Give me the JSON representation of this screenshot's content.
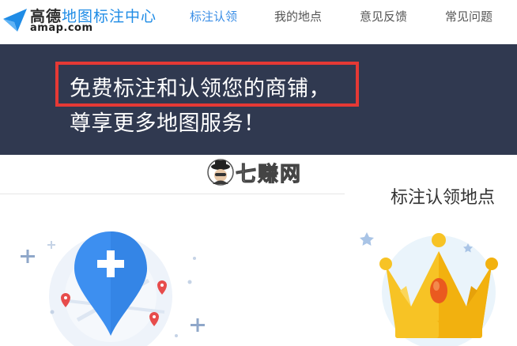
{
  "header": {
    "brand_main": "高德",
    "brand_sub": "地图标注中心",
    "domain": "amap.com",
    "nav": [
      {
        "label": "标注认领",
        "active": true
      },
      {
        "label": "我的地点",
        "active": false
      },
      {
        "label": "意见反馈",
        "active": false
      },
      {
        "label": "常见问题",
        "active": false
      }
    ]
  },
  "banner": {
    "line1": "免费标注和认领您的商铺，",
    "line2": "尊享更多地图服务！",
    "highlight_color": "#e53935",
    "background": "#303950"
  },
  "watermark": {
    "text": "七赚网"
  },
  "card": {
    "title": "标注认领地点"
  },
  "colors": {
    "accent": "#3a8ee6",
    "pin_blue": "#3d8ff0",
    "crown_yellow": "#f7c325"
  },
  "icons": [
    "amap-logo-icon",
    "map-pin-icon",
    "plus-icon",
    "crown-icon",
    "watermark-avatar-icon"
  ]
}
